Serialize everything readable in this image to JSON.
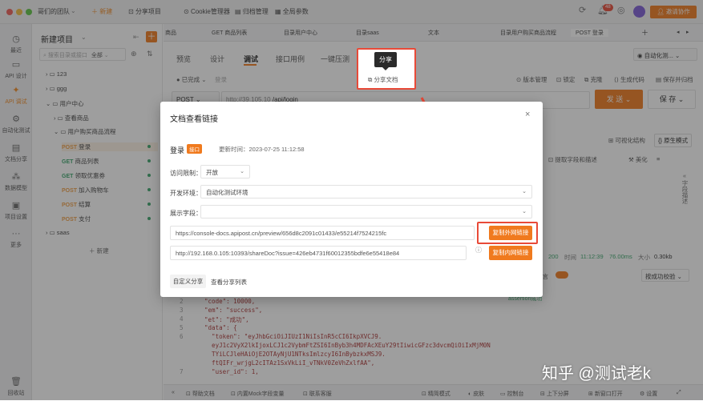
{
  "topbar": {
    "team": "哥们的团队",
    "new_label": "新建",
    "share_project": "分享项目",
    "cookie_manager": "Cookie管理器",
    "archive": "归档管理",
    "global_params": "全局参数",
    "notify_count": "48",
    "invite": "邀请协作"
  },
  "leftnav": {
    "items": [
      "最近",
      "API 设计",
      "API 调试",
      "自动化测试",
      "文档分享",
      "数据模型",
      "项目设置",
      "更多"
    ],
    "recycle": "回收站"
  },
  "tree": {
    "title": "新建项目",
    "search_placeholder": "搜索目录或接口",
    "filter": "全部",
    "folders": [
      "123",
      "ggg",
      "用户中心"
    ],
    "sub_folders": [
      "查看商品",
      "用户购买商品流程"
    ],
    "apis": [
      {
        "method": "POST",
        "name": "登录"
      },
      {
        "method": "GET",
        "name": "商品列表"
      },
      {
        "method": "GET",
        "name": "领取优惠券"
      },
      {
        "method": "POST",
        "name": "加入购物车"
      },
      {
        "method": "POST",
        "name": "结算"
      },
      {
        "method": "POST",
        "name": "支付"
      }
    ],
    "saas": "saas",
    "new_label": "新建"
  },
  "main": {
    "tabs": [
      "商品",
      "GET 商品列表",
      "目录用户中心",
      "目录saas",
      "文本",
      "目录用户购买商品流程",
      "POST 登录"
    ],
    "subtabs": [
      "预览",
      "设计",
      "调试",
      "接口用例",
      "一键压测"
    ],
    "env": "自动化测...",
    "status": "已完成",
    "owner": "登录",
    "share_doc": "分享文档",
    "tooltip": "分享",
    "tools": [
      "版本管理",
      "锁定",
      "克隆",
      "生成代码",
      "保存并归档"
    ],
    "method": "POST",
    "url": "http://39.105.10",
    "path": "/api/login",
    "send": "发 送",
    "save": "保 存",
    "visual": "可视化结构",
    "raw": "原生模式",
    "extract": "提取字段和描述",
    "beautify": "美化",
    "side_label": "字段描述",
    "resp": {
      "code": "200",
      "time_label": "时间",
      "time": "11:12:39",
      "ms": "76.00ms",
      "size_label": "大小",
      "size": "0.30kb"
    },
    "assert": "断言",
    "assert_sel": "按成功校验",
    "assert_hint": "assertion成功",
    "code_lines": [
      {
        "n": "2",
        "t": "  \"code\": 10000,"
      },
      {
        "n": "3",
        "t": "  \"em\": \"success\","
      },
      {
        "n": "4",
        "t": "  \"et\": \"成功\","
      },
      {
        "n": "5",
        "t": "  \"data\": {"
      },
      {
        "n": "6",
        "t": "    \"token\": \"eyJhbGciOiJIUzI1NiIsInR5cCI6IkpXVCJ9."
      },
      {
        "n": "",
        "t": "    eyJ1c2VyX2lkIjoxLCJ1c2VybmFtZSI6InByb3h4MDFAcXEuY29tIiwicGFzc3dvcmQiOiIxMjM0N"
      },
      {
        "n": "",
        "t": "    TYiLCJleHAiOjE2OTAyNjU1NTksImlzcyI6InBybzkxMSJ9."
      },
      {
        "n": "",
        "t": "    ftQIFr_wrjgL2cITAz1SxVkLiI_vTNkV0ZeVhZxlfAA\","
      },
      {
        "n": "7",
        "t": "    \"user_id\": 1,"
      }
    ]
  },
  "modal": {
    "title": "文档查看链接",
    "api_name": "登录",
    "api_badge": "接口",
    "updated": "更新时间：2023-07-25 11:12:58",
    "access_label": "访问限制：",
    "access_value": "开放",
    "env_label": "开发环境：",
    "env_value": "自动化测试环境",
    "fields_label": "展示字段：",
    "external_url": "https://console-docs.apipost.cn/preview/656d8c2091c01433/e55214f7524215fc",
    "copy_external": "复制外网链接",
    "internal_url": "http://192.168.0.105:10393/shareDoc?issue=426eb4731f60012355bdfe6e55418e84",
    "copy_internal": "复制内网链接",
    "custom_share": "自定义分享",
    "view_list": "查看分享列表"
  },
  "bottombar": [
    "帮助文档",
    "内置Mock字段变量",
    "联系客服",
    "精简模式",
    "皮肤",
    "控制台",
    "上下分屏",
    "新窗口打开",
    "设置"
  ],
  "watermark": "知乎 @测试老k"
}
